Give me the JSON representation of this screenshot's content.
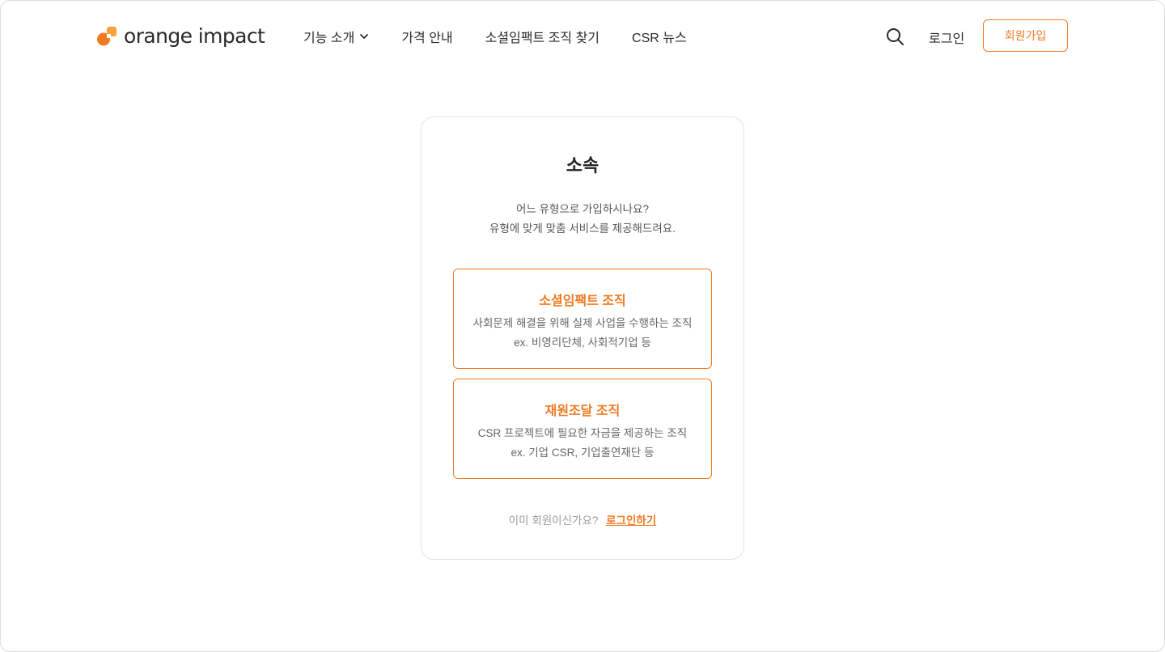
{
  "brand": {
    "name": "orange impact",
    "accent_color": "#f07a23",
    "logo_icon": "orange-impact-logo-icon"
  },
  "header": {
    "nav": [
      {
        "label": "기능 소개",
        "has_dropdown": true
      },
      {
        "label": "가격 안내"
      },
      {
        "label": "소셜임팩트 조직 찾기"
      },
      {
        "label": "CSR 뉴스"
      }
    ],
    "search_icon": "search-icon",
    "login_label": "로그인",
    "signup_label": "회원가입"
  },
  "card": {
    "title": "소속",
    "subtitle_line1": "어느 유형으로 가입하시나요?",
    "subtitle_line2": "유형에 맞게 맞춤 서비스를 제공해드려요.",
    "options": [
      {
        "title": "소셜임팩트 조직",
        "desc_line1": "사회문제 해결을 위해 실제 사업을 수행하는 조직",
        "desc_line2": "ex. 비영리단체, 사회적기업 등"
      },
      {
        "title": "재원조달 조직",
        "desc_line1": "CSR 프로젝트에 필요한 자금을 제공하는 조직",
        "desc_line2": "ex. 기업 CSR, 기업출연재단 등"
      }
    ],
    "footer_question": "이미 회원이신가요?",
    "footer_login_link": "로그인하기"
  }
}
